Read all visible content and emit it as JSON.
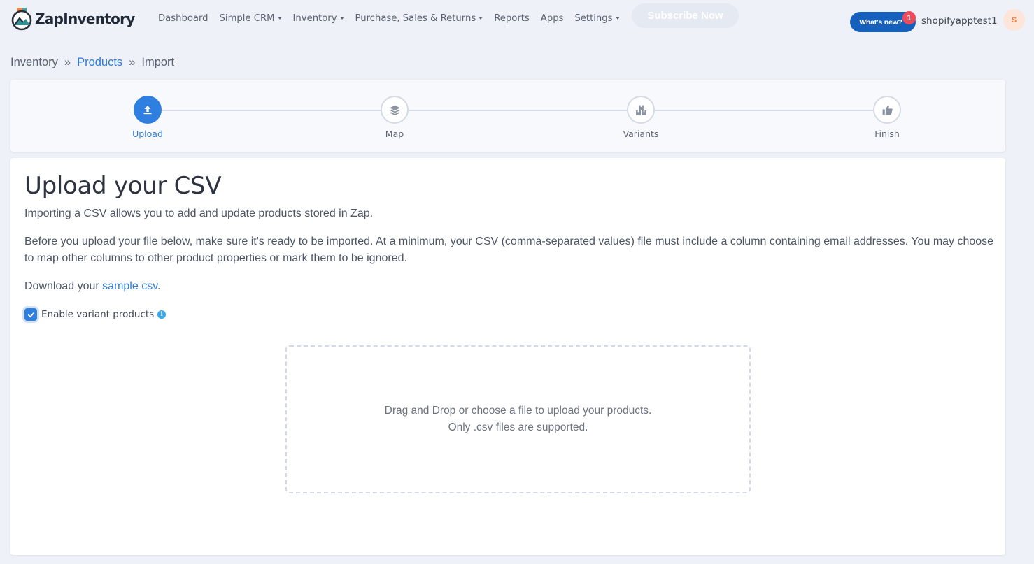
{
  "app": {
    "brand": "ZapInventory"
  },
  "nav": [
    {
      "label": "Dashboard",
      "dropdown": false
    },
    {
      "label": "Simple CRM",
      "dropdown": true
    },
    {
      "label": "Inventory",
      "dropdown": true
    },
    {
      "label": "Purchase, Sales & Returns",
      "dropdown": true
    },
    {
      "label": "Reports",
      "dropdown": false
    },
    {
      "label": "Apps",
      "dropdown": false
    },
    {
      "label": "Settings",
      "dropdown": true
    }
  ],
  "header": {
    "subscribe_label": "Subscribe Now",
    "whats_new_label": "What's new?",
    "notification_count": "1",
    "username": "shopifyapptest1",
    "avatar_initial": "S"
  },
  "breadcrumb": {
    "root": "Inventory",
    "separator": "»",
    "products": "Products",
    "current": "Import"
  },
  "steps": [
    {
      "label": "Upload",
      "icon": "upload-icon",
      "active": true
    },
    {
      "label": "Map",
      "icon": "layers-icon",
      "active": false
    },
    {
      "label": "Variants",
      "icon": "boxes-icon",
      "active": false
    },
    {
      "label": "Finish",
      "icon": "thumbs-up-icon",
      "active": false
    }
  ],
  "content": {
    "title": "Upload your CSV",
    "intro": "Importing a CSV allows you to add and update products stored in Zap.",
    "instructions": "Before you upload your file below, make sure it's ready to be imported. At a minimum, your CSV (comma-separated values) file must include a column containing email addresses. You may choose to map other columns to other product properties or mark them to be ignored.",
    "download_prefix": "Download your ",
    "download_link": "sample csv",
    "download_suffix": ".",
    "variant_checkbox_label": "Enable variant products",
    "variant_checkbox_checked": true,
    "dropzone_line1": "Drag and Drop or choose a file to upload your products.",
    "dropzone_line2": "Only .csv files are supported."
  },
  "colors": {
    "accent": "#2e7fe0",
    "link": "#2f7bd8",
    "whats_new_bg": "#1560bd",
    "badge": "#ef4a5a",
    "background": "#eef1f8"
  }
}
